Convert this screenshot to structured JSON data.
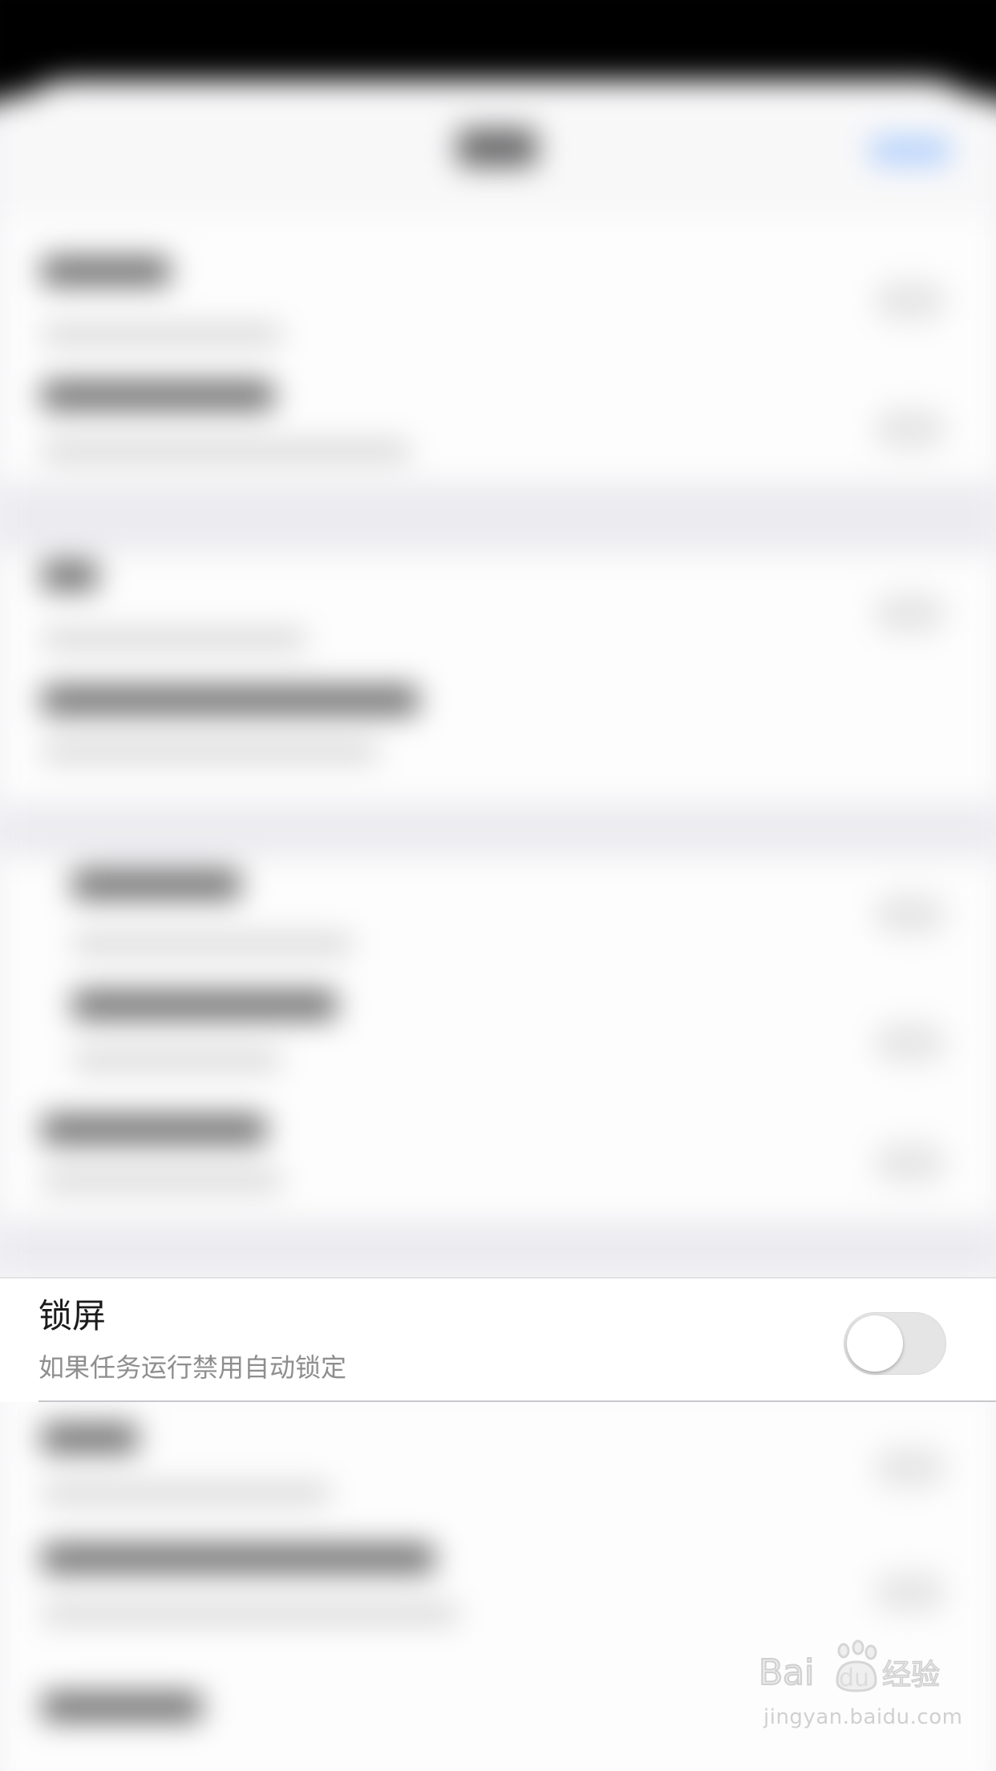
{
  "settings": {
    "lock_screen": {
      "title": "锁屏",
      "subtitle": "如果任务运行禁用自动锁定",
      "toggle_on": false
    }
  },
  "watermark": {
    "logo_text": "Baidu经验",
    "url": "jingyan.baidu.com"
  },
  "colors": {
    "toggle_off_track": "#e5e5e5",
    "title_text": "#1b1b1b",
    "subtitle_text": "#8e8e8e",
    "nav_accent": "#7fb3ff"
  }
}
